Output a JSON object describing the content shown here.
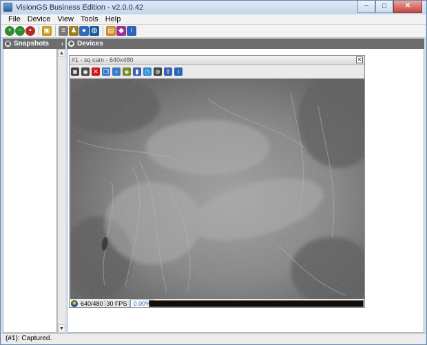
{
  "window": {
    "title": "VisionGS Business Edition - v2.0.0.42",
    "minimize_glyph": "–",
    "maximize_glyph": "□",
    "close_glyph": "✕"
  },
  "menu": [
    "File",
    "Device",
    "View",
    "Tools",
    "Help"
  ],
  "toolbar": {
    "buttons": [
      {
        "icon": "add-device-icon",
        "glyph": "+",
        "color": "#2e8b2e"
      },
      {
        "icon": "remove-device-icon",
        "glyph": "−",
        "color": "#2e8b2e"
      },
      {
        "icon": "device-settings-icon",
        "glyph": "•",
        "color": "#b02a2a"
      },
      {
        "icon": "folder-icon",
        "glyph": "▣",
        "color": "#c49a1c"
      },
      {
        "icon": "document-icon",
        "glyph": "≡",
        "color": "#7a7a7a"
      },
      {
        "icon": "scale-icon",
        "glyph": "♟",
        "color": "#a07c1d"
      },
      {
        "icon": "camera-group-icon",
        "glyph": "●",
        "color": "#2f6bb8"
      },
      {
        "icon": "globe-icon",
        "glyph": "◍",
        "color": "#1c5aa0"
      },
      {
        "icon": "report-icon",
        "glyph": "▤",
        "color": "#c98b2a"
      },
      {
        "icon": "book-icon",
        "glyph": "◆",
        "color": "#a0308f"
      },
      {
        "icon": "info-icon",
        "glyph": "i",
        "color": "#2a64b8"
      }
    ]
  },
  "snapshots_panel": {
    "title": "Snapshots",
    "collapse_glyph": "‹"
  },
  "devices_panel": {
    "title": "Devices"
  },
  "camera_window": {
    "title": "#1 - sq cam - 640x480",
    "close_glyph": "✕",
    "toolbar": [
      {
        "icon": "camera-icon",
        "glyph": "◙",
        "color": "#444444"
      },
      {
        "icon": "webcam-icon",
        "glyph": "◉",
        "color": "#444444"
      },
      {
        "icon": "delete-icon",
        "glyph": "✕",
        "color": "#d01818"
      },
      {
        "icon": "copy-icon",
        "glyph": "❐",
        "color": "#3a78c8"
      },
      {
        "icon": "chat-icon",
        "glyph": "○",
        "color": "#3a78c8"
      },
      {
        "icon": "motion-detect-icon",
        "glyph": "◈",
        "color": "#7a8a2a"
      },
      {
        "icon": "record-icon",
        "glyph": "▮",
        "color": "#3a5fb0"
      },
      {
        "icon": "schedule-icon",
        "glyph": "◷",
        "color": "#2a8ad0"
      },
      {
        "icon": "network-icon",
        "glyph": "⊕",
        "color": "#444444"
      },
      {
        "icon": "upload-icon",
        "glyph": "⇪",
        "color": "#3a5fb0"
      },
      {
        "icon": "info-icon",
        "glyph": "i",
        "color": "#2a64b8"
      }
    ],
    "status": {
      "resolution": "640/480",
      "fps": "30 FPS",
      "percent": "0.00%",
      "badge_glyph": "✱"
    }
  },
  "statusbar": {
    "text": "(#1): Captured."
  }
}
